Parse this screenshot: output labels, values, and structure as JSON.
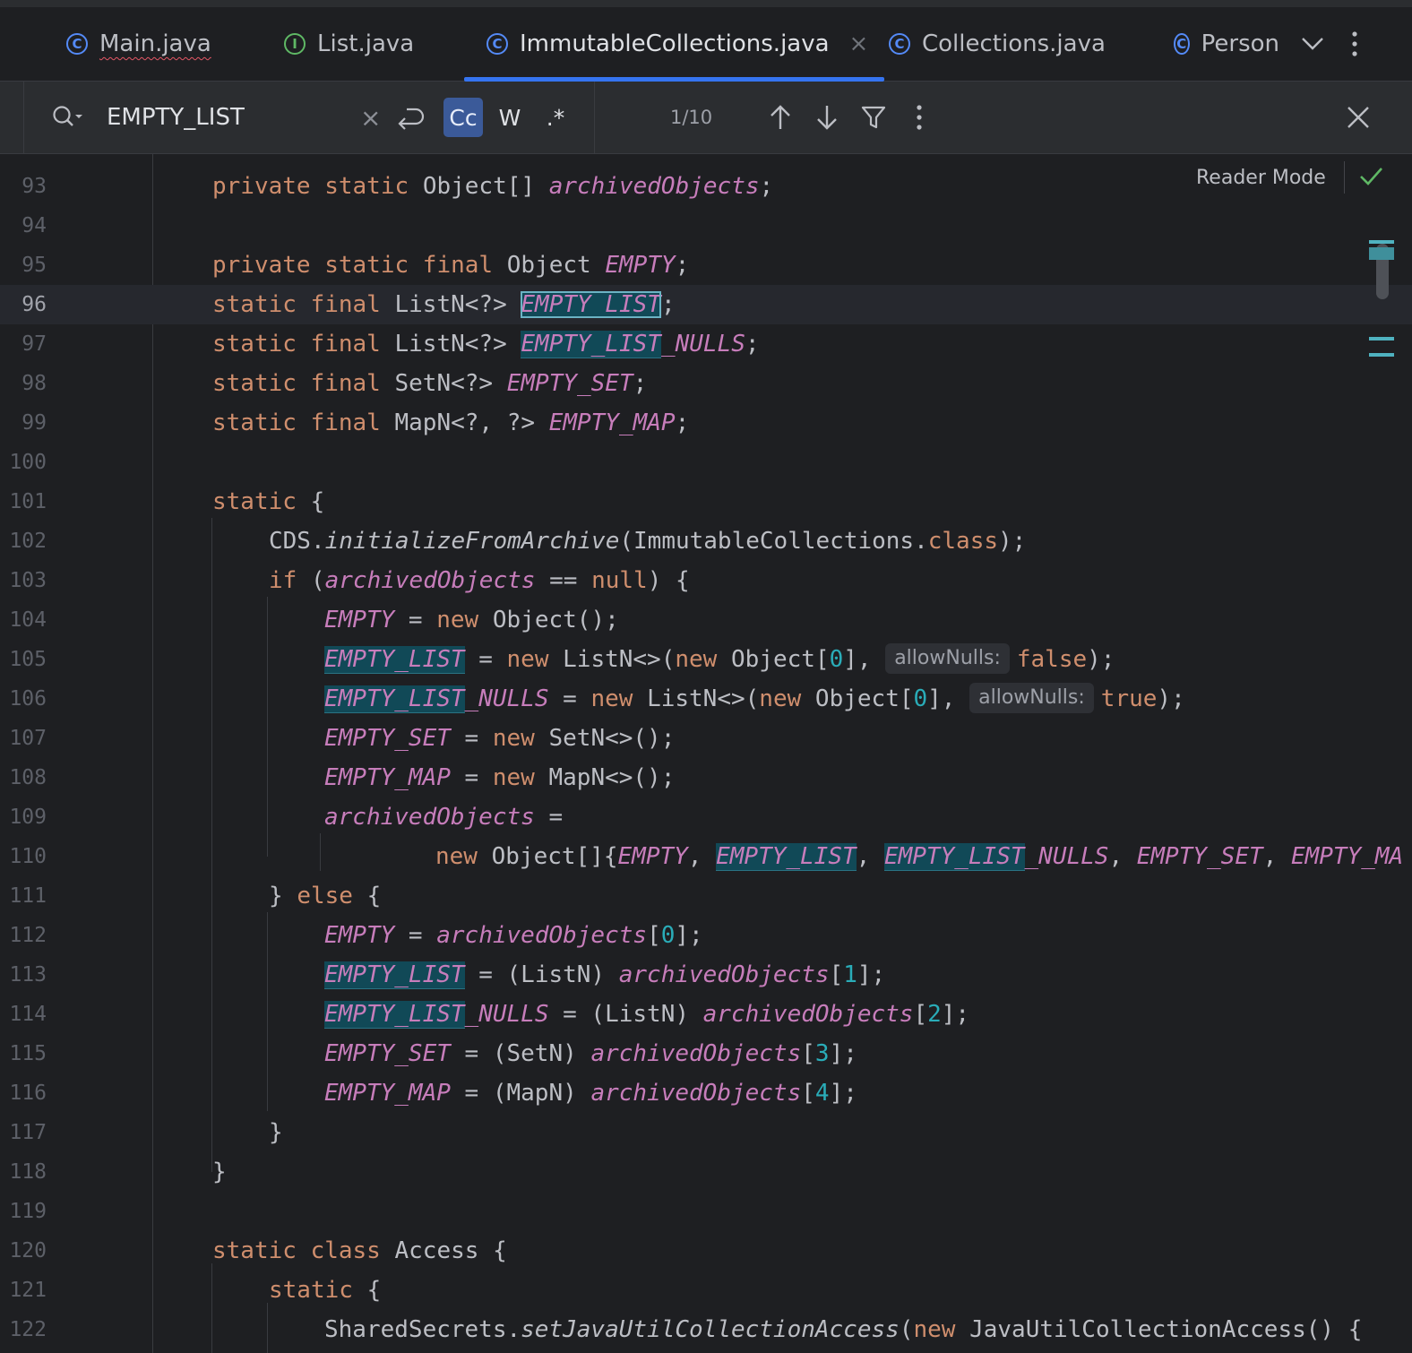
{
  "tabs": [
    {
      "label": "Main.java",
      "icon": "class-icon",
      "icon_glyph": "C"
    },
    {
      "label": "List.java",
      "icon": "interface-icon",
      "icon_glyph": "I"
    },
    {
      "label": "ImmutableCollections.java",
      "icon": "class-icon",
      "icon_glyph": "C",
      "active": true
    },
    {
      "label": "Collections.java",
      "icon": "class-icon",
      "icon_glyph": "C"
    },
    {
      "label": "Person",
      "icon": "class-icon",
      "icon_glyph": "C"
    }
  ],
  "tab_close_glyph": "×",
  "tab_overflow_glyph": "⌄",
  "more_glyph": "⋮",
  "find": {
    "query": "EMPTY_LIST",
    "clear_glyph": "×",
    "match_case_label": "Cc",
    "words_label": "W",
    "regex_label": ".*",
    "counter": "1/10",
    "match_case_enabled": true
  },
  "editor": {
    "reader_mode_label": "Reader Mode",
    "line_numbers": [
      "93",
      "94",
      "95",
      "96",
      "97",
      "98",
      "99",
      "100",
      "101",
      "102",
      "103",
      "104",
      "105",
      "106",
      "107",
      "108",
      "109",
      "110",
      "111",
      "112",
      "113",
      "114",
      "115",
      "116",
      "117",
      "118",
      "119",
      "120",
      "121",
      "122"
    ],
    "current_line": "96",
    "hint_label": "allowNulls:"
  },
  "colors": {
    "background": "#1e1f22",
    "keyword": "#cf8e6d",
    "field": "#c77dbb",
    "number": "#2aacb8",
    "search_highlight": "#114957",
    "accent": "#3574f0"
  }
}
